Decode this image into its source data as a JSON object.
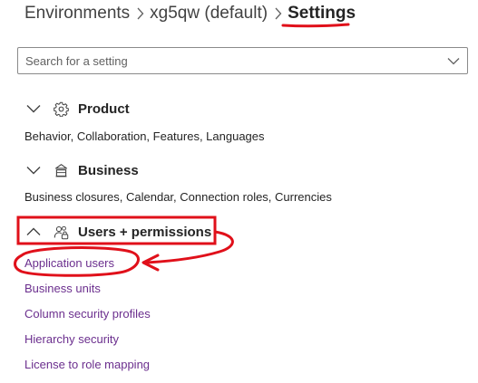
{
  "breadcrumb": {
    "items": [
      "Environments",
      "xg5qw (default)",
      "Settings"
    ],
    "separator_icon": "chevron-right-icon"
  },
  "search": {
    "placeholder": "Search for a setting",
    "dropdown_icon": "chevron-down-icon"
  },
  "sections": [
    {
      "title": "Product",
      "icon": "gear-icon",
      "expanded": false,
      "description": "Behavior, Collaboration, Features, Languages"
    },
    {
      "title": "Business",
      "icon": "building-icon",
      "expanded": false,
      "description": "Business closures, Calendar, Connection roles, Currencies"
    },
    {
      "title": "Users + permissions",
      "icon": "people-lock-icon",
      "expanded": true,
      "links": [
        "Application users",
        "Business units",
        "Column security profiles",
        "Hierarchy security",
        "License to role mapping"
      ]
    }
  ],
  "colors": {
    "link": "#6b2f8e",
    "annotation": "#e0101a",
    "text": "#242424"
  }
}
